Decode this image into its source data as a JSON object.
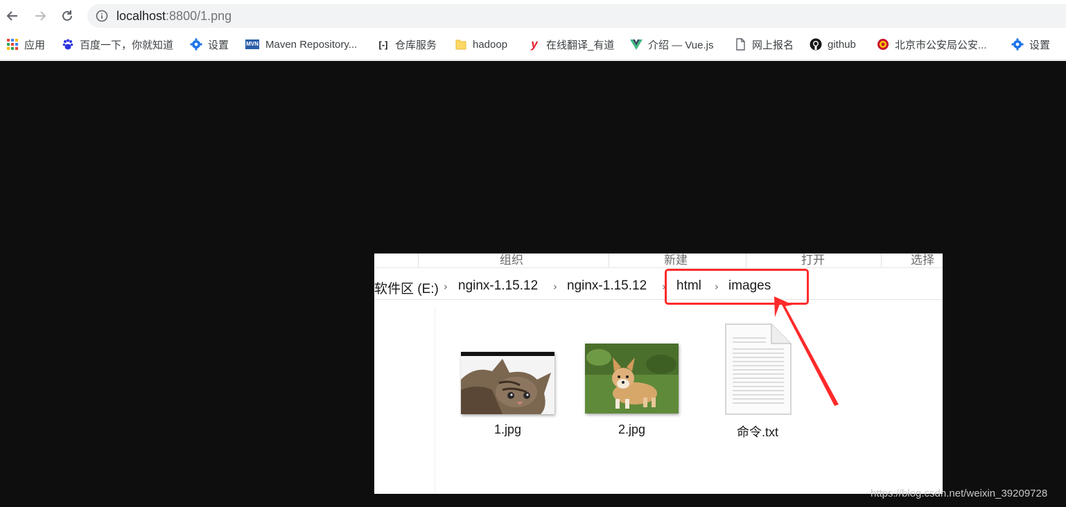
{
  "browser": {
    "url_host": "localhost",
    "url_rest": ":8800/1.png",
    "bookmarks": [
      {
        "label": "应用",
        "icon": "apps-grid-icon"
      },
      {
        "label": "百度一下，你就知道",
        "icon": "baidu-paw-icon"
      },
      {
        "label": "设置",
        "icon": "gear-icon"
      },
      {
        "label": "Maven Repository...",
        "icon": "mvn-icon"
      },
      {
        "label": "仓库服务",
        "icon": "aliyun-icon"
      },
      {
        "label": "hadoop",
        "icon": "folder-icon"
      },
      {
        "label": "在线翻译_有道",
        "icon": "youdao-icon"
      },
      {
        "label": "介绍 — Vue.js",
        "icon": "vue-icon"
      },
      {
        "label": "网上报名",
        "icon": "page-icon"
      },
      {
        "label": "github",
        "icon": "github-icon"
      },
      {
        "label": "北京市公安局公安...",
        "icon": "police-badge-icon"
      },
      {
        "label": "设置",
        "icon": "gear-icon"
      }
    ],
    "bookmark_mvn_text": "MVN",
    "bookmark_aliyun_text": "[-]"
  },
  "explorer": {
    "ribbon": [
      "组织",
      "新建",
      "打开",
      "选择"
    ],
    "breadcrumb": [
      "软件区 (E:)",
      "nginx-1.15.12",
      "nginx-1.15.12",
      "html",
      "images"
    ],
    "files": [
      {
        "name": "1.jpg",
        "type": "kitten-photo"
      },
      {
        "name": "2.jpg",
        "type": "corgi-photo"
      },
      {
        "name": "命令.txt",
        "type": "text-document"
      }
    ],
    "highlight_color": "#ff2a2a"
  },
  "watermark": "https://blog.csdn.net/weixin_39209728"
}
